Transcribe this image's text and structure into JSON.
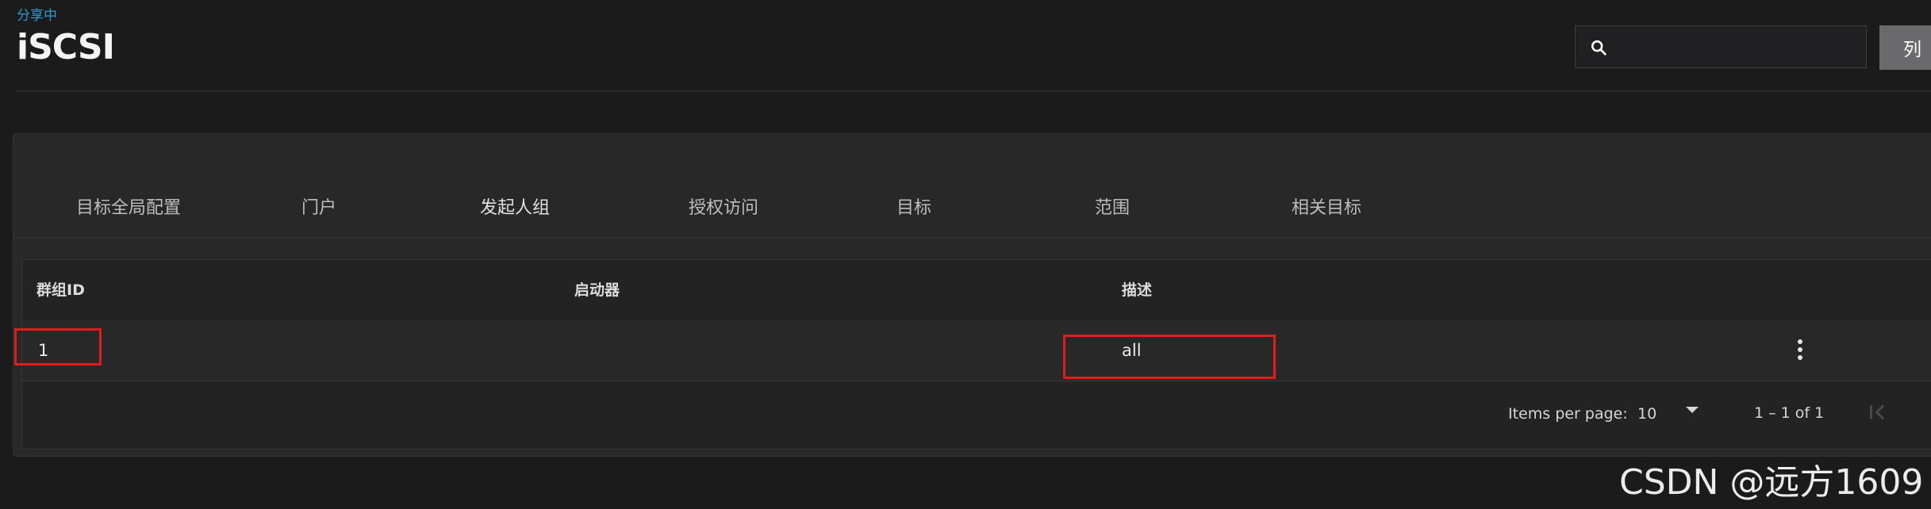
{
  "header": {
    "breadcrumb": "分享中",
    "title": "iSCSI",
    "search": {
      "placeholder": "",
      "value": ""
    },
    "columns_label": "列"
  },
  "tabs": [
    {
      "label": "目标全局配置",
      "active": false
    },
    {
      "label": "门户",
      "active": false
    },
    {
      "label": "发起人组",
      "active": true
    },
    {
      "label": "授权访问",
      "active": false
    },
    {
      "label": "目标",
      "active": false
    },
    {
      "label": "范围",
      "active": false
    },
    {
      "label": "相关目标",
      "active": false
    }
  ],
  "table": {
    "columns": [
      "群组ID",
      "启动器",
      "描述"
    ],
    "rows": [
      {
        "group_id": "1",
        "initiators": "",
        "description": "all"
      }
    ]
  },
  "paginator": {
    "items_per_page_label": "Items per page:",
    "page_size": "10",
    "range": "1 – 1 of 1"
  },
  "watermark": "CSDN @远方1609",
  "colors": {
    "background": "#1b1b1c",
    "card": "#282829",
    "accent": "#2d9bd6",
    "highlight": "#e21b1b"
  },
  "icons": [
    "search-icon",
    "more-vert-icon",
    "first-page-icon",
    "chevron-left-icon",
    "dropdown-arrow-icon"
  ]
}
